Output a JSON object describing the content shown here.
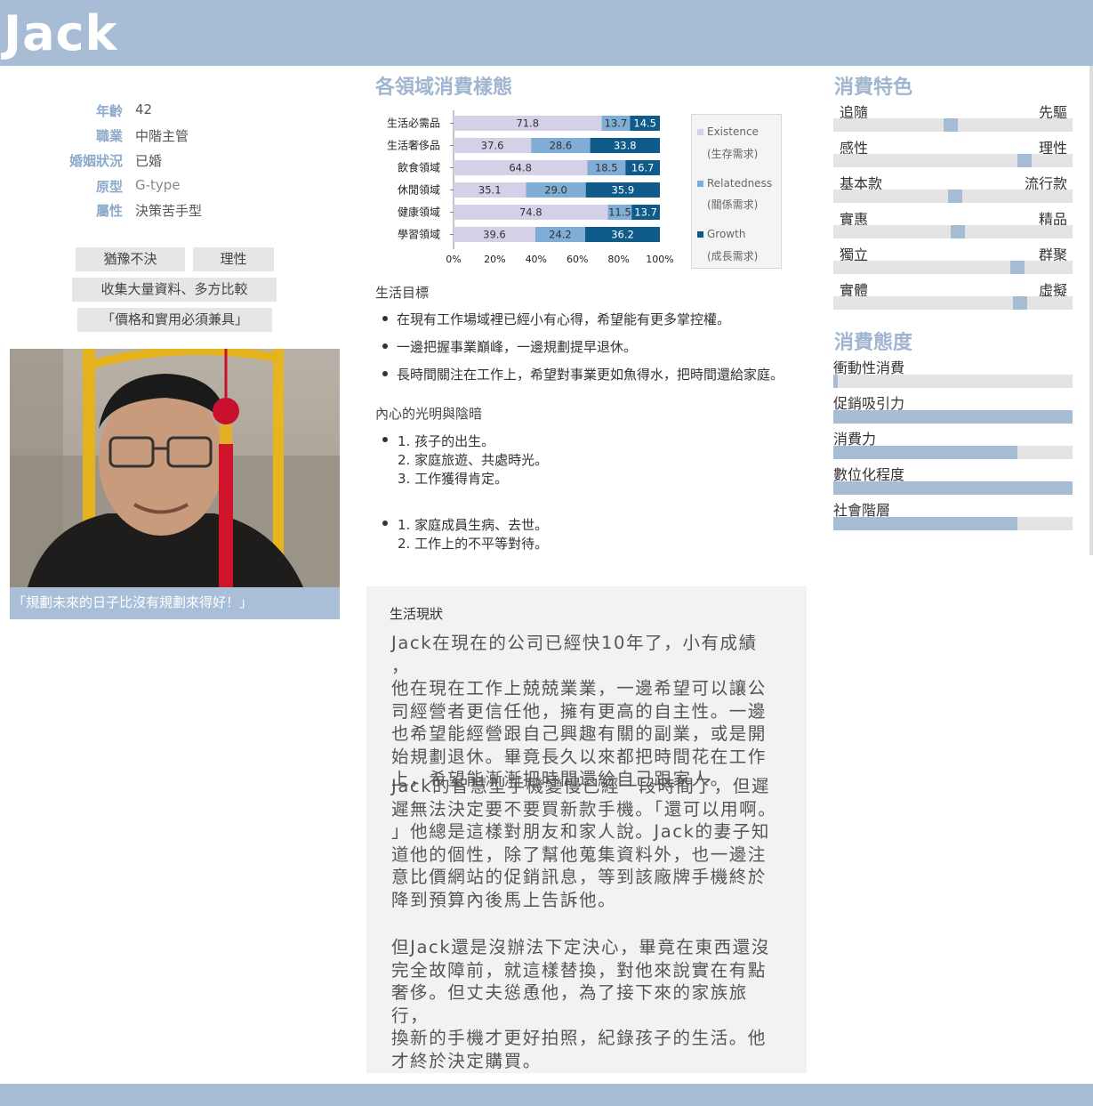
{
  "header": {
    "name": "Jack"
  },
  "profile": {
    "rows": [
      {
        "label": "年齡",
        "value": "42"
      },
      {
        "label": "職業",
        "value": "中階主管"
      },
      {
        "label": "婚姻狀況",
        "value": "已婚"
      },
      {
        "label": "原型",
        "value": "G-type"
      },
      {
        "label": "屬性",
        "value": "決策苦手型"
      }
    ],
    "tags": [
      "猶豫不決",
      "理性",
      "收集大量資料、多方比較",
      "「價格和實用必須兼具」"
    ],
    "quote": "「規劃未來的日子比沒有規劃來得好！」"
  },
  "chart_section": {
    "title": "各領域消費樣態"
  },
  "chart_data": {
    "type": "bar",
    "orientation": "horizontal",
    "stacked": true,
    "categories": [
      "生活必需品",
      "生活奢侈品",
      "飲食領域",
      "休閒領域",
      "健康領域",
      "學習領域"
    ],
    "series": [
      {
        "name": "Existence",
        "sub": "(生存需求)",
        "color": "#d3d0e7",
        "values": [
          71.8,
          37.6,
          64.8,
          35.1,
          74.8,
          39.6
        ]
      },
      {
        "name": "Relatedness",
        "sub": "(關係需求)",
        "color": "#7fadd6",
        "values": [
          13.7,
          28.6,
          18.5,
          29.0,
          11.5,
          24.2
        ]
      },
      {
        "name": "Growth",
        "sub": "(成長需求)",
        "color": "#0e5a88",
        "values": [
          14.5,
          33.8,
          16.7,
          35.9,
          13.7,
          36.2
        ]
      }
    ],
    "value_labels": [
      [
        "71.8",
        "13.7",
        "14.5"
      ],
      [
        "37.6",
        "28.6",
        "33.8"
      ],
      [
        "64.8",
        "18.5",
        "16.7"
      ],
      [
        "35.1",
        "29.0",
        "35.9"
      ],
      [
        "74.8",
        "11.5",
        "13.7"
      ],
      [
        "39.6",
        "24.2",
        "36.2"
      ]
    ],
    "x_ticks": [
      "0%",
      "20%",
      "40%",
      "60%",
      "80%",
      "100%"
    ],
    "xlim": [
      0,
      100
    ],
    "legend_position": "right"
  },
  "goals": {
    "title": "生活目標",
    "items": [
      "在現有工作場域裡已經小有心得，希望能有更多掌控權。",
      "一邊把握事業巔峰，一邊規劃提早退休。",
      "長時間關注在工作上，希望對事業更如魚得水，把時間還給家庭。"
    ]
  },
  "light_dark": {
    "title": "內心的光明與陰暗",
    "light": [
      "1. 孩子的出生。",
      "2. 家庭旅遊、共處時光。",
      "3. 工作獲得肯定。"
    ],
    "dark": [
      "1. 家庭成員生病、去世。",
      "2. 工作上的不平等對待。"
    ]
  },
  "status": {
    "title": "生活現狀",
    "p1": [
      "Jack在現在的公司已經快10年了，小有成績 ，",
      "他在現在工作上兢兢業業，一邊希望可以讓公",
      "司經營者更信任他，擁有更高的自主性。一邊",
      "也希望能經營跟自己興趣有關的副業，或是開",
      "始規劃退休。畢竟長久以來都把時間花在工作",
      "上，希望能漸漸把時間還給自己跟家人。"
    ],
    "p2": [
      "Jack的智慧型手機變慢已經一段時間了，但遲",
      "遲無法決定要不要買新款手機。「還可以用啊。",
      "」他總是這樣對朋友和家人說。Jack的妻子知",
      "道他的個性，除了幫他蒐集資料外，也一邊注",
      "意比價網站的促銷訊息，等到該廠牌手機終於",
      "降到預算內後馬上告訴他。"
    ],
    "p3": [
      "但Jack還是沒辦法下定決心，畢竟在東西還沒",
      "完全故障前，就這樣替換，對他來說實在有點",
      "奢侈。但丈夫慫恿他，為了接下來的家族旅行，",
      "換新的手機才更好拍照，紀錄孩子的生活。他",
      "才終於決定購買。"
    ]
  },
  "traits": {
    "title": "消費特色",
    "items": [
      {
        "left": "追隨",
        "right": "先驅",
        "level": 0.49
      },
      {
        "left": "感性",
        "right": "理性",
        "level": 0.8
      },
      {
        "left": "基本款",
        "right": "流行款",
        "level": 0.51
      },
      {
        "left": "實惠",
        "right": "精品",
        "level": 0.52
      },
      {
        "left": "獨立",
        "right": "群聚",
        "level": 0.77
      },
      {
        "left": "實體",
        "right": "虛擬",
        "level": 0.78
      }
    ]
  },
  "attitude": {
    "title": "消費態度",
    "items": [
      {
        "label": "衝動性消費",
        "level": 0.02
      },
      {
        "label": "促銷吸引力",
        "level": 1.0
      },
      {
        "label": "消費力",
        "level": 0.77
      },
      {
        "label": "數位化程度",
        "level": 1.0
      },
      {
        "label": "社會階層",
        "level": 0.77
      }
    ]
  }
}
